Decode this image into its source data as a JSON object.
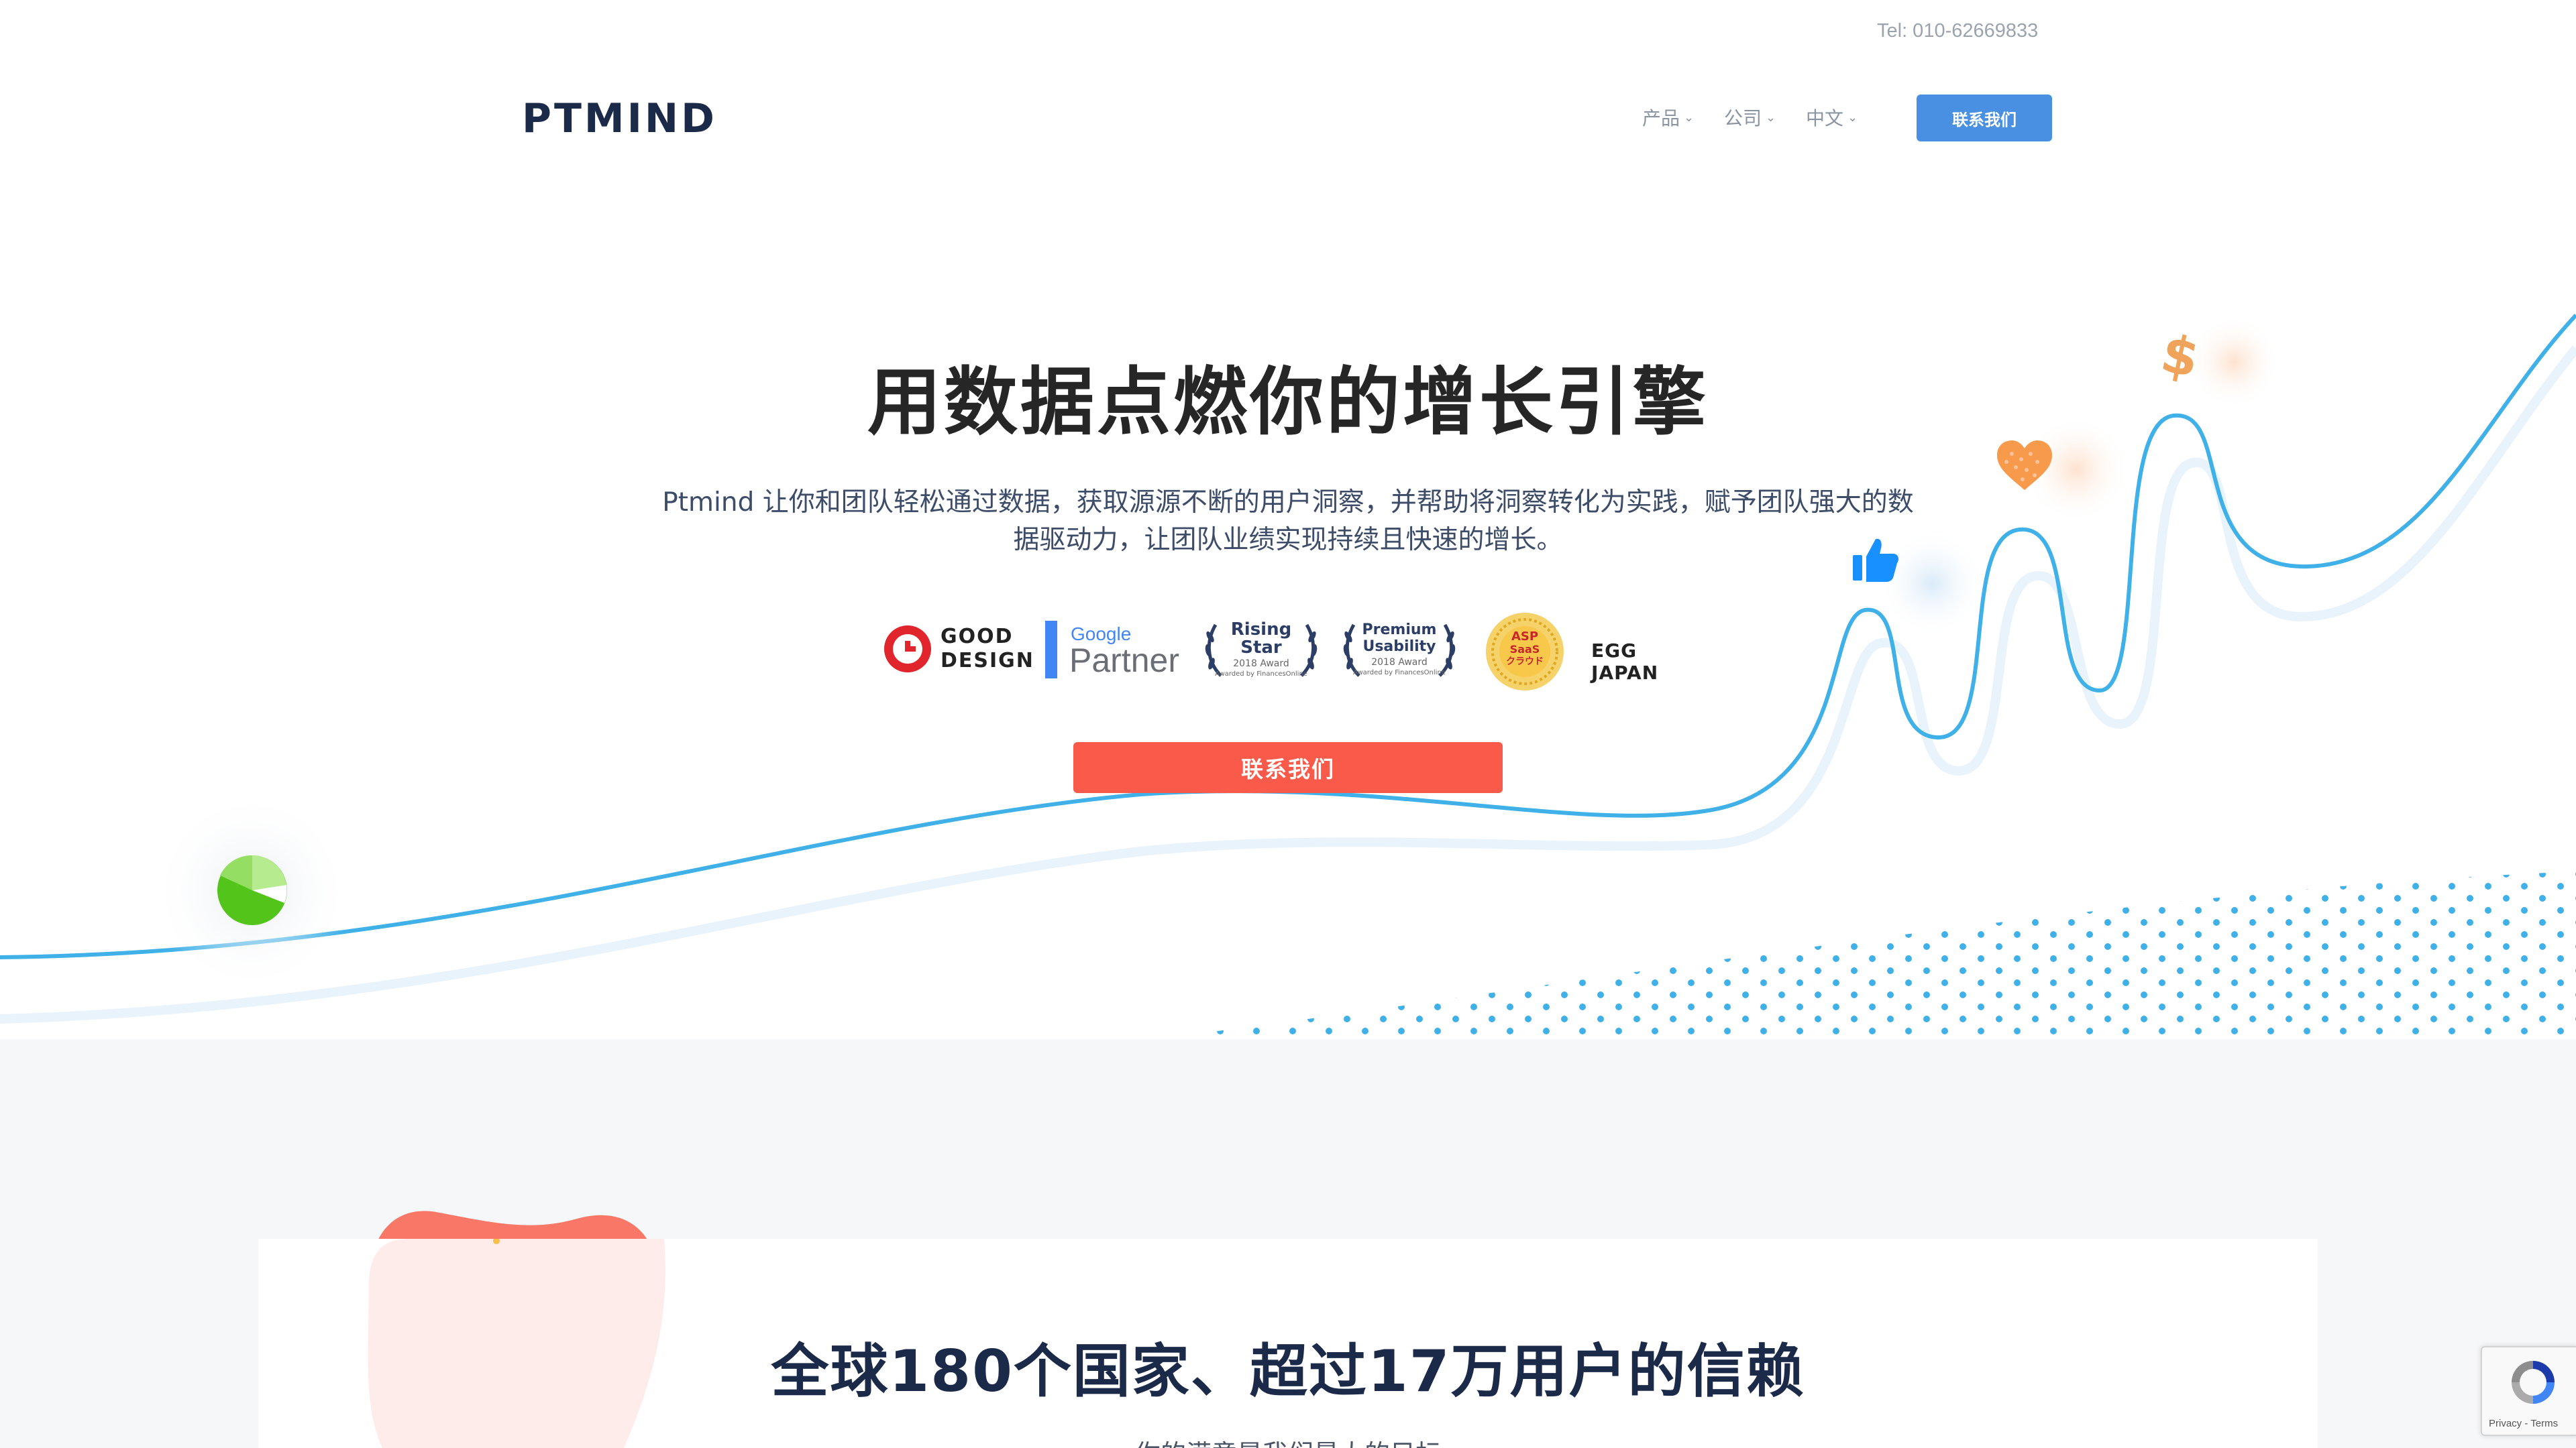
{
  "topbar": {
    "tel": "Tel: 010-62669833"
  },
  "header": {
    "logo_text": "PTMIND",
    "nav": [
      {
        "label": "产品"
      },
      {
        "label": "公司"
      },
      {
        "label": "中文"
      }
    ],
    "contact_button": "联系我们"
  },
  "hero": {
    "title": "用数据点燃你的增长引擎",
    "subtitle_line1": "Ptmind 让你和团队轻松通过数据，获取源源不断的用户洞察，并帮助将洞察转化为实践，赋予团队强大的数",
    "subtitle_line2": "据驱动力，让团队业绩实现持续且快速的增长。",
    "cta_label": "联系我们",
    "badges": {
      "good_design_line1": "GOOD",
      "good_design_line2": "DESIGN",
      "google_word": "Google",
      "partner_word": "Partner",
      "rising_line1": "Rising",
      "rising_line2": "Star",
      "rising_year": "2018 Award",
      "premium_line1": "Premium",
      "premium_line2": "Usability",
      "premium_year": "2018 Award",
      "awarded_by": "Awarded by FinancesOnline",
      "asp_line1": "ASP",
      "asp_line2": "SaaS",
      "asp_line3": "クラウド",
      "egg_japan": "EGG JAPAN"
    }
  },
  "trust_section": {
    "title": "全球180个国家、超过17万用户的信赖",
    "subtitle": "你的满意是我们最大的目标"
  },
  "recaptcha": {
    "privacy": "Privacy",
    "separator": " - ",
    "terms": "Terms"
  },
  "colors": {
    "brand_blue": "#4a90e2",
    "cta_red": "#fa5a4a",
    "line_blue": "#3fb0e8",
    "title_dark": "#1c2a4a"
  },
  "icons": [
    "pie-chart-icon",
    "thumbs-up-icon",
    "heart-icon",
    "dollar-icon",
    "recaptcha-icon"
  ]
}
